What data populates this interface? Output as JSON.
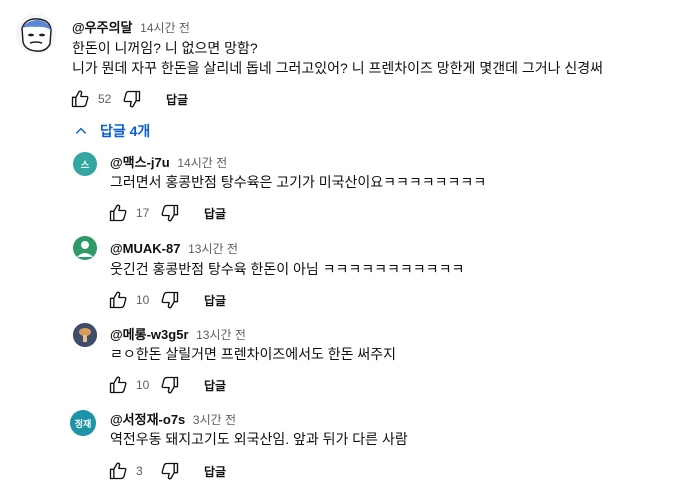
{
  "main_comment": {
    "author": "@우주의달",
    "time": "14시간 전",
    "lines": [
      "한돈이 니꺼임? 니 없으면 망함?",
      "니가 뭔데 자꾸 한돈을 살리네 돕네 그러고있어? 니 프렌차이즈 망한게 몇갠데 그거나 신경써"
    ],
    "likes": "52",
    "reply_label": "답글"
  },
  "replies_toggle": {
    "label": "답글 4개"
  },
  "replies": [
    {
      "author": "@맥스-j7u",
      "time": "14시간 전",
      "text": "그러면서 홍콩반점 탕수육은 고기가 미국산이요ㅋㅋㅋㅋㅋㅋㅋㅋ",
      "likes": "17",
      "reply_label": "답글",
      "avatar_letter": "스",
      "avatar_color": "#33a6a0"
    },
    {
      "author": "@MUAK-87",
      "time": "13시간 전",
      "text": "웃긴건 홍콩반점 탕수육 한돈이 아님 ㅋㅋㅋㅋㅋㅋㅋㅋㅋㅋㅋ",
      "likes": "10",
      "reply_label": "답글",
      "avatar_letter": "",
      "avatar_color": "#2e9a67"
    },
    {
      "author": "@메롱-w3g5r",
      "time": "13시간 전",
      "text": "ㄹㅇ한돈 살릴거면 프렌차이즈에서도 한돈 써주지",
      "likes": "10",
      "reply_label": "답글",
      "avatar_letter": "",
      "avatar_color": "#4a5a78"
    },
    {
      "author": "@서정재-o7s",
      "time": "3시간 전",
      "text": "역전우동 돼지고기도 외국산임. 앞과 뒤가 다른 사람",
      "likes": "3",
      "reply_label": "답글",
      "avatar_letter": "정재",
      "avatar_color": "#1e93a6"
    }
  ],
  "icons": {
    "like": "thumbs-up-icon",
    "dislike": "thumbs-down-icon",
    "chevron": "chevron-up-icon"
  },
  "colors": {
    "link_blue": "#065fd4",
    "secondary_text": "#606060"
  }
}
